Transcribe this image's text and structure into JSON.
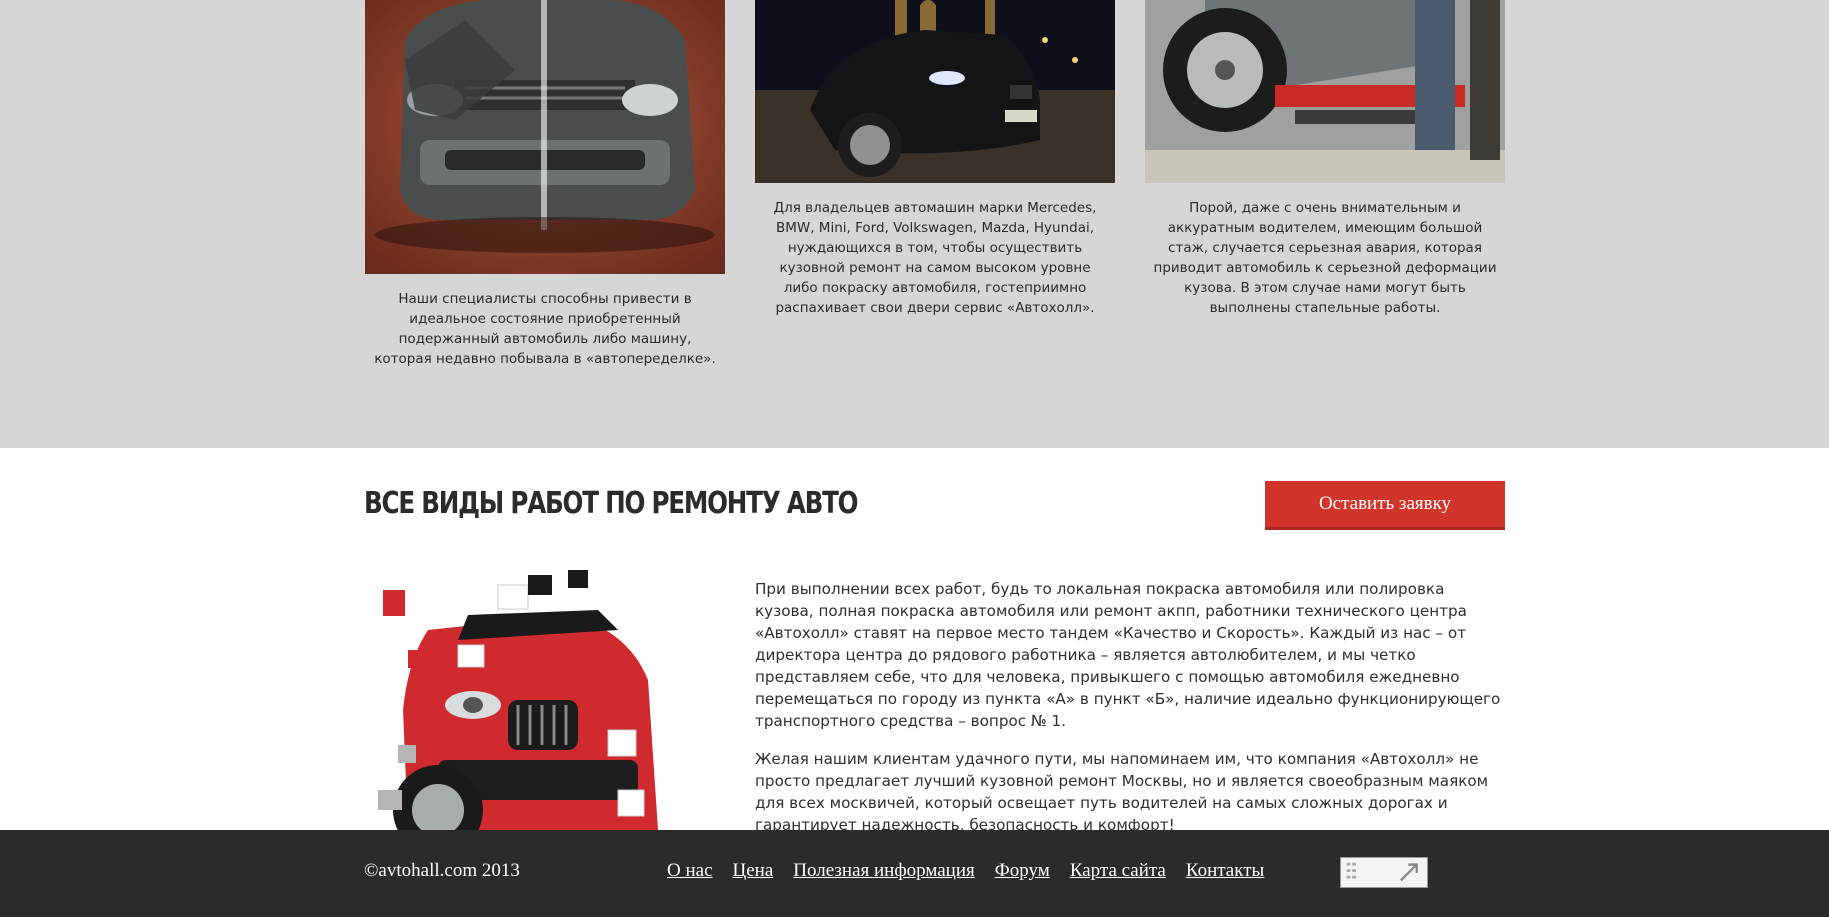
{
  "cards": [
    {
      "image": "damaged-suv-photo",
      "caption": "Наши специалисты способны привести в идеальное состояние приобретенный подержанный автомобиль либо машину, которая недавно побывала в «автопеределке»."
    },
    {
      "image": "bmw-night-photo",
      "caption": "Для владельцев автомашин марки Mercedes, BMW, Mini, Ford, Volkswagen, Mazda, Hyundai, нуждающихся в том, чтобы осуществить кузовной ремонт на самом высоком уровне либо покраску автомобиля, гостеприимно распахивает свои двери сервис «Автохолл»."
    },
    {
      "image": "frame-straightening-photo",
      "caption": "Порой, даже с очень внимательным и аккуратным водителем, имеющим большой стаж, случается серьезная авария, которая приводит автомобиль к серьезной деформации кузова. В этом случае нами могут быть выполнены стапельные работы."
    }
  ],
  "section": {
    "title": "ВСЕ ВИДЫ РАБОТ ПО РЕМОНТУ АВТО",
    "cta_label": "Оставить заявку",
    "paragraphs": [
      "При выполнении всех работ, будь то локальная покраска автомобиля или полировка кузова, полная покраска автомобиля или ремонт акпп, работники технического центра «Автохолл» ставят на первое место тандем «Качество и Скорость». Каждый из нас – от директора центра до рядового работника – является автолюбителем, и мы четко представляем себе, что для человека, привыкшего с помощью автомобиля ежедневно перемещаться по городу из пункта «А» в пункт «Б», наличие идеально функционирующего транспортного средства – вопрос № 1.",
      "Желая нашим клиентам удачного пути, мы напоминаем им, что компания «Автохолл» не просто предлагает лучший кузовной ремонт Москвы, но и является своеобразным маяком для всех москвичей, который освещает путь водителей на самых сложных дорогах и гарантирует надежность, безопасность и комфорт!"
    ]
  },
  "footer": {
    "copyright": "©avtohall.com 2013",
    "nav": [
      "О нас",
      "Цена",
      "Полезная информация",
      "Форум",
      "Карта сайта",
      "Контакты"
    ]
  },
  "colors": {
    "accent": "#d0342a",
    "band_gray": "#d6d6d6",
    "footer_bg": "#2b2b2b"
  }
}
